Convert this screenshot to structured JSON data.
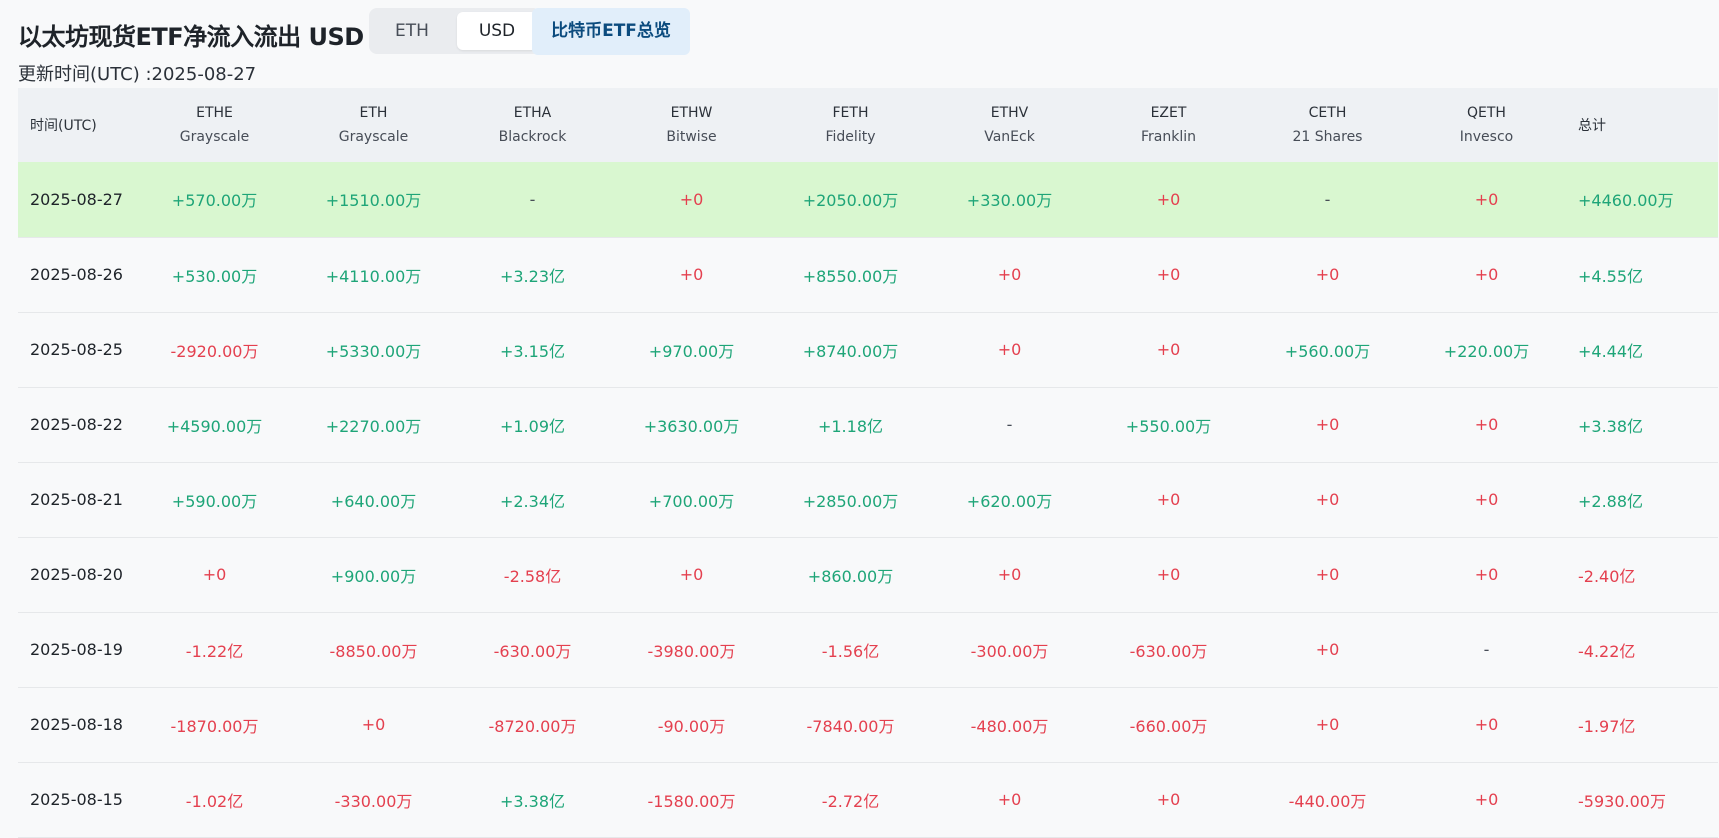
{
  "header": {
    "title": "以太坊现货ETF净流入流出 USD",
    "unit_toggle": {
      "eth_label": "ETH",
      "usd_label": "USD",
      "selected": "USD"
    },
    "btc_link_label": "比特币ETF总览",
    "updated_text": "更新时间(UTC) :2025-08-27"
  },
  "table": {
    "date_header": "时间(UTC)",
    "total_header": "总计",
    "columns": [
      {
        "code": "ETHE",
        "issuer": "Grayscale"
      },
      {
        "code": "ETH",
        "issuer": "Grayscale"
      },
      {
        "code": "ETHA",
        "issuer": "Blackrock"
      },
      {
        "code": "ETHW",
        "issuer": "Bitwise"
      },
      {
        "code": "FETH",
        "issuer": "Fidelity"
      },
      {
        "code": "ETHV",
        "issuer": "VanEck"
      },
      {
        "code": "EZET",
        "issuer": "Franklin"
      },
      {
        "code": "CETH",
        "issuer": "21 Shares"
      },
      {
        "code": "QETH",
        "issuer": "Invesco"
      }
    ],
    "rows": [
      {
        "date": "2025-08-27",
        "highlight": true,
        "values": [
          "+570.00万",
          "+1510.00万",
          "-",
          "+0",
          "+2050.00万",
          "+330.00万",
          "+0",
          "-",
          "+0"
        ],
        "total": "+4460.00万"
      },
      {
        "date": "2025-08-26",
        "highlight": false,
        "values": [
          "+530.00万",
          "+4110.00万",
          "+3.23亿",
          "+0",
          "+8550.00万",
          "+0",
          "+0",
          "+0",
          "+0"
        ],
        "total": "+4.55亿"
      },
      {
        "date": "2025-08-25",
        "highlight": false,
        "values": [
          "-2920.00万",
          "+5330.00万",
          "+3.15亿",
          "+970.00万",
          "+8740.00万",
          "+0",
          "+0",
          "+560.00万",
          "+220.00万"
        ],
        "total": "+4.44亿"
      },
      {
        "date": "2025-08-22",
        "highlight": false,
        "values": [
          "+4590.00万",
          "+2270.00万",
          "+1.09亿",
          "+3630.00万",
          "+1.18亿",
          "-",
          "+550.00万",
          "+0",
          "+0"
        ],
        "total": "+3.38亿"
      },
      {
        "date": "2025-08-21",
        "highlight": false,
        "values": [
          "+590.00万",
          "+640.00万",
          "+2.34亿",
          "+700.00万",
          "+2850.00万",
          "+620.00万",
          "+0",
          "+0",
          "+0"
        ],
        "total": "+2.88亿"
      },
      {
        "date": "2025-08-20",
        "highlight": false,
        "values": [
          "+0",
          "+900.00万",
          "-2.58亿",
          "+0",
          "+860.00万",
          "+0",
          "+0",
          "+0",
          "+0"
        ],
        "total": "-2.40亿"
      },
      {
        "date": "2025-08-19",
        "highlight": false,
        "values": [
          "-1.22亿",
          "-8850.00万",
          "-630.00万",
          "-3980.00万",
          "-1.56亿",
          "-300.00万",
          "-630.00万",
          "+0",
          "-"
        ],
        "total": "-4.22亿"
      },
      {
        "date": "2025-08-18",
        "highlight": false,
        "values": [
          "-1870.00万",
          "+0",
          "-8720.00万",
          "-90.00万",
          "-7840.00万",
          "-480.00万",
          "-660.00万",
          "+0",
          "+0"
        ],
        "total": "-1.97亿"
      },
      {
        "date": "2025-08-15",
        "highlight": false,
        "values": [
          "-1.02亿",
          "-330.00万",
          "+3.38亿",
          "-1580.00万",
          "-2.72亿",
          "+0",
          "+0",
          "-440.00万",
          "+0"
        ],
        "total": "-5930.00万"
      }
    ]
  },
  "colors": {
    "positive": "#1ea578",
    "negative": "#e4404f",
    "highlight_row": "#d9f7d0",
    "header_row": "#eef1f4"
  }
}
